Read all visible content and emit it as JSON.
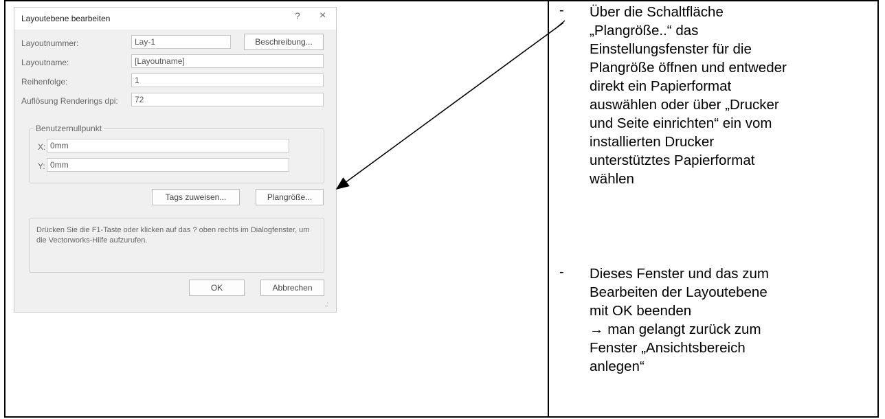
{
  "dialog": {
    "title": "Layoutebene bearbeiten",
    "help_glyph": "?",
    "close_glyph": "×",
    "fields": {
      "layoutnummer": {
        "label": "Layoutnummer:",
        "value": "Lay-1"
      },
      "layoutname": {
        "label": "Layoutname:",
        "value": "[Layoutname]"
      },
      "reihenfolge": {
        "label": "Reihenfolge:",
        "value": "1"
      },
      "aufloesung": {
        "label": "Auflösung Renderings dpi:",
        "value": "72"
      }
    },
    "beschreibung_button": "Beschreibung...",
    "benutzernullpunkt": {
      "legend": "Benutzernullpunkt",
      "x_label": "X:",
      "x_value": "0mm",
      "y_label": "Y:",
      "y_value": "0mm"
    },
    "tags_button": "Tags zuweisen...",
    "plangroesse_button": "Plangröße...",
    "help_text": "Drücken Sie die F1-Taste oder klicken auf das ? oben rechts im Dialogfenster, um die Vectorworks-Hilfe aufzurufen.",
    "ok_button": "OK",
    "cancel_button": "Abbrechen",
    "resize_grip": "..:"
  },
  "instructions": [
    {
      "bullet": "-",
      "lines": [
        "Über die Schaltfläche",
        "„Plangröße..“ das",
        "Einstellungsfenster für die",
        "Plangröße öffnen und entweder",
        "direkt ein Papierformat",
        "auswählen oder über „Drucker",
        "und Seite einrichten“ ein vom",
        "installierten Drucker",
        "unterstütztes Papierformat",
        "wählen"
      ]
    },
    {
      "bullet": "-",
      "lines": [
        "Dieses Fenster und das zum",
        "Bearbeiten der Layoutebene",
        "mit OK beenden",
        "→ man gelangt zurück zum",
        "Fenster „Ansichtsbereich",
        "anlegen“"
      ]
    }
  ],
  "colors": {
    "dialog_background": "#f0f0f0",
    "text": "#000000",
    "arrow": "#000000"
  }
}
